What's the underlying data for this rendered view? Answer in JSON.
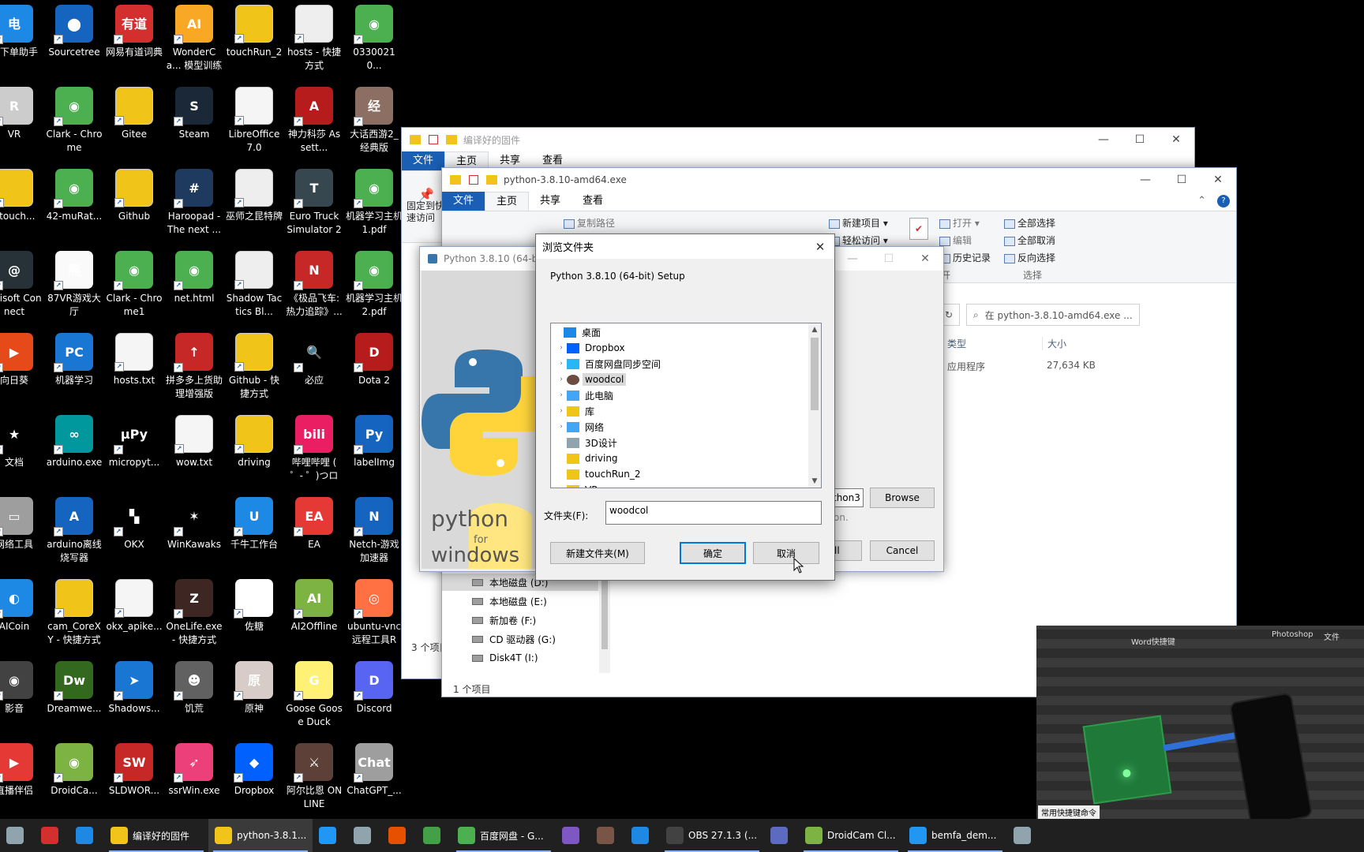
{
  "desktop": {
    "icons": [
      {
        "label": "千下单助手",
        "color": "#1e88e5",
        "glyph": "电"
      },
      {
        "label": "Sourcetree",
        "color": "#1565c0",
        "glyph": "⬤"
      },
      {
        "label": "网易有道词典",
        "color": "#d32f2f",
        "glyph": "有道"
      },
      {
        "label": "WonderCa... 模型训练工...",
        "color": "#f9a825",
        "glyph": "AI"
      },
      {
        "label": "touchRun_2",
        "color": "#f0c419",
        "glyph": ""
      },
      {
        "label": "hosts - 快捷方式",
        "color": "#eeeeee",
        "glyph": ""
      },
      {
        "label": "03300210...",
        "color": "#4caf50",
        "glyph": "◉"
      },
      {
        "label": "VR",
        "color": "#cccccc",
        "glyph": "R"
      },
      {
        "label": "Clark - Chrome",
        "color": "#4caf50",
        "glyph": "◉"
      },
      {
        "label": "Gitee",
        "color": "#f0c419",
        "glyph": ""
      },
      {
        "label": "Steam",
        "color": "#1b2838",
        "glyph": "S"
      },
      {
        "label": "LibreOffice 7.0",
        "color": "#f5f5f5",
        "glyph": ""
      },
      {
        "label": "神力科莎 Assett...",
        "color": "#b71c1c",
        "glyph": "A"
      },
      {
        "label": "大话西游2_经典版",
        "color": "#8d6e63",
        "glyph": "经"
      },
      {
        "label": "fitouch...",
        "color": "#f0c419",
        "glyph": ""
      },
      {
        "label": "42-muRat...",
        "color": "#4caf50",
        "glyph": "◉"
      },
      {
        "label": "Github",
        "color": "#f0c419",
        "glyph": ""
      },
      {
        "label": "Haroopad - The next ...",
        "color": "#1e3a5f",
        "glyph": "#"
      },
      {
        "label": "巫师之昆特牌",
        "color": "#eeeeee",
        "glyph": ""
      },
      {
        "label": "Euro Truck Simulator 2",
        "color": "#37474f",
        "glyph": "T"
      },
      {
        "label": "机器学习主机 1.pdf",
        "color": "#4caf50",
        "glyph": "◉"
      },
      {
        "label": "Ubisoft Connect",
        "color": "#263238",
        "glyph": "@"
      },
      {
        "label": "87VR游戏大厅",
        "color": "#fafafa",
        "glyph": "熊"
      },
      {
        "label": "Clark - Chrome1",
        "color": "#4caf50",
        "glyph": "◉"
      },
      {
        "label": "net.html",
        "color": "#4caf50",
        "glyph": "◉"
      },
      {
        "label": "Shadow Tactics Bl...",
        "color": "#eeeeee",
        "glyph": ""
      },
      {
        "label": "《极品飞车:热力追踪》...",
        "color": "#c62828",
        "glyph": "N"
      },
      {
        "label": "机器学习主机 2.pdf",
        "color": "#4caf50",
        "glyph": "◉"
      },
      {
        "label": "向日葵",
        "color": "#e64a19",
        "glyph": "▶"
      },
      {
        "label": "机器学习",
        "color": "#1976d2",
        "glyph": "PC"
      },
      {
        "label": "hosts.txt",
        "color": "#f5f5f5",
        "glyph": ""
      },
      {
        "label": "拼多多上货助理增强版",
        "color": "#c62828",
        "glyph": "↑"
      },
      {
        "label": "Github - 快捷方式",
        "color": "#f0c419",
        "glyph": ""
      },
      {
        "label": "必应",
        "color": "#000000",
        "glyph": "🔍"
      },
      {
        "label": "Dota 2",
        "color": "#b71c1c",
        "glyph": "D"
      },
      {
        "label": "文档",
        "color": "#000000",
        "glyph": "★"
      },
      {
        "label": "arduino.exe",
        "color": "#00979d",
        "glyph": "∞"
      },
      {
        "label": "micropyt...",
        "color": "#000000",
        "glyph": "μPy"
      },
      {
        "label": "wow.txt",
        "color": "#f5f5f5",
        "glyph": ""
      },
      {
        "label": "driving",
        "color": "#f0c419",
        "glyph": ""
      },
      {
        "label": "哔哩哔哩 ( ゜- ゜)つロ ...",
        "color": "#e91e63",
        "glyph": "bili"
      },
      {
        "label": "labelImg",
        "color": "#1565c0",
        "glyph": "Py"
      },
      {
        "label": "网络工具",
        "color": "#9e9e9e",
        "glyph": "▭"
      },
      {
        "label": "arduino离线烧写器",
        "color": "#1565c0",
        "glyph": "A"
      },
      {
        "label": "OKX",
        "color": "#000000",
        "glyph": "▚"
      },
      {
        "label": "WinKawaks",
        "color": "#000000",
        "glyph": "✶"
      },
      {
        "label": "千牛工作台",
        "color": "#1e88e5",
        "glyph": "U"
      },
      {
        "label": "EA",
        "color": "#e53935",
        "glyph": "EA"
      },
      {
        "label": "Netch-游戏加速器",
        "color": "#1565c0",
        "glyph": "N"
      },
      {
        "label": "AICoin",
        "color": "#1e88e5",
        "glyph": "◐"
      },
      {
        "label": "cam_CoreXY - 快捷方式",
        "color": "#f0c419",
        "glyph": ""
      },
      {
        "label": "okx_apike...",
        "color": "#f5f5f5",
        "glyph": ""
      },
      {
        "label": "OneLife.exe - 快捷方式",
        "color": "#3e2723",
        "glyph": "Z"
      },
      {
        "label": "佐糖",
        "color": "#ffffff",
        "glyph": "✎"
      },
      {
        "label": "AI2Offline",
        "color": "#7cb342",
        "glyph": "AI"
      },
      {
        "label": "ubuntu-vnc 远程工具Re...",
        "color": "#ff7043",
        "glyph": "◎"
      },
      {
        "label": "影音",
        "color": "#424242",
        "glyph": "◉"
      },
      {
        "label": "Dreamwe...",
        "color": "#33691e",
        "glyph": "Dw"
      },
      {
        "label": "Shadows...",
        "color": "#1976d2",
        "glyph": "➤"
      },
      {
        "label": "饥荒",
        "color": "#616161",
        "glyph": "☻"
      },
      {
        "label": "原神",
        "color": "#d7ccc8",
        "glyph": "原"
      },
      {
        "label": "Goose Goose Duck",
        "color": "#fff176",
        "glyph": "G"
      },
      {
        "label": "Discord",
        "color": "#5865f2",
        "glyph": "D"
      },
      {
        "label": "直播伴侣",
        "color": "#e53935",
        "glyph": "▶"
      },
      {
        "label": "DroidCa...",
        "color": "#7cb342",
        "glyph": "◉"
      },
      {
        "label": "SLDWOR...",
        "color": "#c62828",
        "glyph": "SW"
      },
      {
        "label": "ssrWin.exe",
        "color": "#ec407a",
        "glyph": "➶"
      },
      {
        "label": "Dropbox",
        "color": "#0061fe",
        "glyph": "◆"
      },
      {
        "label": "阿尔比恩 ONLINE",
        "color": "#5d4037",
        "glyph": "⚔"
      },
      {
        "label": "ChatGPT_...",
        "color": "#9e9e9e",
        "glyph": "Chat"
      }
    ]
  },
  "explorer_back": {
    "title": "编译好的固件",
    "tabs": [
      "文件",
      "主页",
      "共享",
      "查看"
    ],
    "pin_label": "固定到快速访问",
    "status": "3 个项目"
  },
  "explorer_front": {
    "title": "python-3.8.10-amd64.exe",
    "tabs": [
      "文件",
      "主页",
      "共享",
      "查看"
    ],
    "ribbon": {
      "copy_path": "复制路径",
      "new_item": "新建项目",
      "easy_access": "轻松访问",
      "open": "打开",
      "edit": "编辑",
      "history": "历史记录",
      "open_group": "打开",
      "select_all": "全部选择",
      "select_none": "全部取消",
      "invert": "反向选择",
      "select_group": "选择"
    },
    "search_placeholder": "在 python-3.8.10-amd64.exe ...",
    "columns": [
      "类型",
      "大小"
    ],
    "file": {
      "type": "应用程序",
      "size": "27,634 KB"
    },
    "drives": [
      "本地磁盘 (D:)",
      "本地磁盘 (E:)",
      "新加卷 (F:)",
      "CD 驱动器 (G:)",
      "Disk4T (I:)"
    ],
    "status": "1 个项目"
  },
  "installer": {
    "title": "Python 3.8.10 (64-bit) Setup",
    "title_visible": "Python 3.8.10 (64-bit",
    "brand_line1": "python",
    "brand_line2": "for",
    "brand_line3": "windows",
    "path_fragment": "thon3",
    "browse": "Browse",
    "note_fragment": "on.",
    "install_fragment": "ll",
    "cancel": "Cancel"
  },
  "folder_dialog": {
    "title": "浏览文件夹",
    "subtitle": "Python 3.8.10 (64-bit) Setup",
    "tree": [
      {
        "label": "桌面",
        "level": 0,
        "expander": "",
        "icon": "desktop"
      },
      {
        "label": "Dropbox",
        "level": 1,
        "expander": "›",
        "icon": "dropbox"
      },
      {
        "label": "百度网盘同步空间",
        "level": 1,
        "expander": "›",
        "icon": "baidu"
      },
      {
        "label": "woodcol",
        "level": 1,
        "expander": "›",
        "icon": "user",
        "selected": true
      },
      {
        "label": "此电脑",
        "level": 1,
        "expander": "›",
        "icon": "pc"
      },
      {
        "label": "库",
        "level": 1,
        "expander": "›",
        "icon": "lib"
      },
      {
        "label": "网络",
        "level": 1,
        "expander": "›",
        "icon": "net"
      },
      {
        "label": "3D设计",
        "level": 1,
        "expander": "",
        "icon": "search"
      },
      {
        "label": "driving",
        "level": 1,
        "expander": "",
        "icon": "folder"
      },
      {
        "label": "touchRun_2",
        "level": 1,
        "expander": "",
        "icon": "folder"
      },
      {
        "label": "VR",
        "level": 1,
        "expander": "",
        "icon": "folder"
      }
    ],
    "folder_label": "文件夹(F):",
    "folder_value": "woodcol",
    "new_folder": "新建文件夹(M)",
    "ok": "确定",
    "cancel": "取消"
  },
  "webcam": {
    "label_top": "Word快捷键",
    "label_photoshop": "Photoshop",
    "label_wen": "文件",
    "label_bottom": "常用快捷键命令"
  },
  "taskbar": {
    "items": [
      {
        "label": "",
        "color": "#90a4ae"
      },
      {
        "label": "",
        "color": "#d32f2f"
      },
      {
        "label": "",
        "color": "#1e88e5"
      },
      {
        "label": "编译好的固件",
        "color": "#f0c419",
        "running": true
      },
      {
        "label": "python-3.8.1...",
        "color": "#f0c419",
        "running": true,
        "active": true
      },
      {
        "label": "",
        "color": "#2196f3"
      },
      {
        "label": "",
        "color": "#90a4ae"
      },
      {
        "label": "",
        "color": "#e65100"
      },
      {
        "label": "",
        "color": "#43a047"
      },
      {
        "label": "百度网盘 - G...",
        "color": "#4caf50",
        "running": true
      },
      {
        "label": "",
        "color": "#7e57c2"
      },
      {
        "label": "",
        "color": "#795548"
      },
      {
        "label": "",
        "color": "#1e88e5"
      },
      {
        "label": "OBS 27.1.3 (...",
        "color": "#424242",
        "running": true
      },
      {
        "label": "",
        "color": "#5c6bc0"
      },
      {
        "label": "DroidCam Cl...",
        "color": "#7cb342",
        "running": true
      },
      {
        "label": "bemfa_dem...",
        "color": "#2196f3",
        "running": true
      },
      {
        "label": "",
        "color": "#90a4ae"
      }
    ]
  }
}
